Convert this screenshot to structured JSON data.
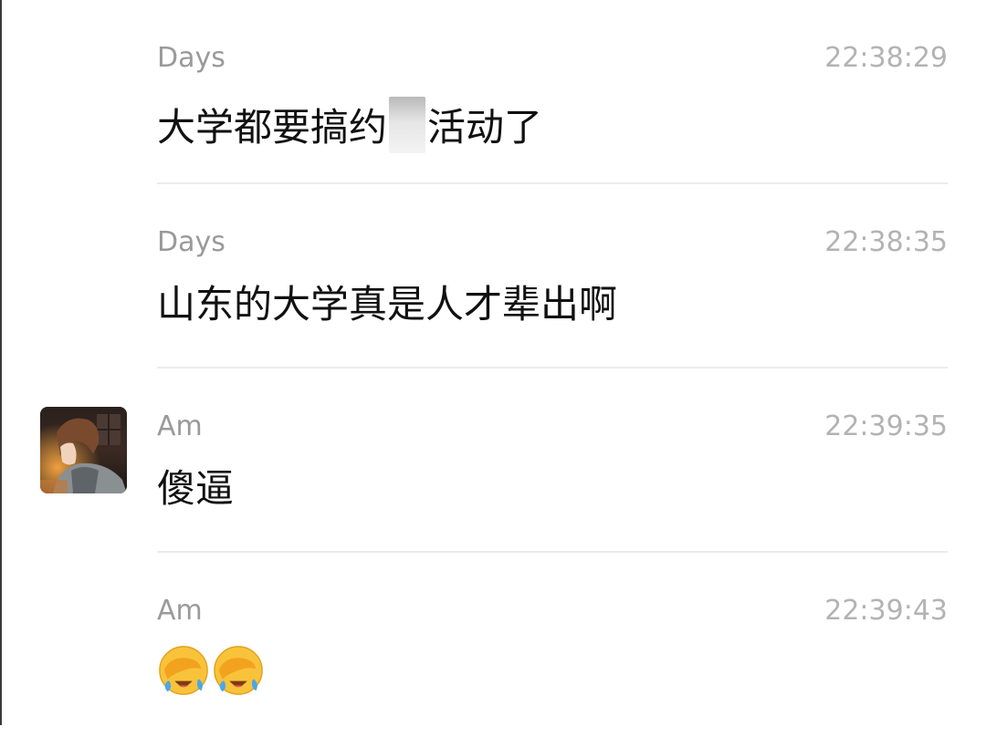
{
  "messages": [
    {
      "sender": "Days",
      "time": "22:38:29",
      "text_before": "大学都要搞约",
      "text_after": "活动了",
      "censored": true
    },
    {
      "sender": "Days",
      "time": "22:38:35",
      "text": "山东的大学真是人才辈出啊"
    },
    {
      "sender": "Am",
      "time": "22:39:35",
      "text": "傻逼",
      "avatar": "anime-character-avatar"
    },
    {
      "sender": "Am",
      "time": "22:39:43",
      "emojis": [
        "facepalm-crying-emoji",
        "facepalm-crying-emoji"
      ]
    }
  ],
  "colors": {
    "sender": "#9a9a9a",
    "time": "#b3b3b3",
    "text": "#111111",
    "divider": "#ececec"
  }
}
